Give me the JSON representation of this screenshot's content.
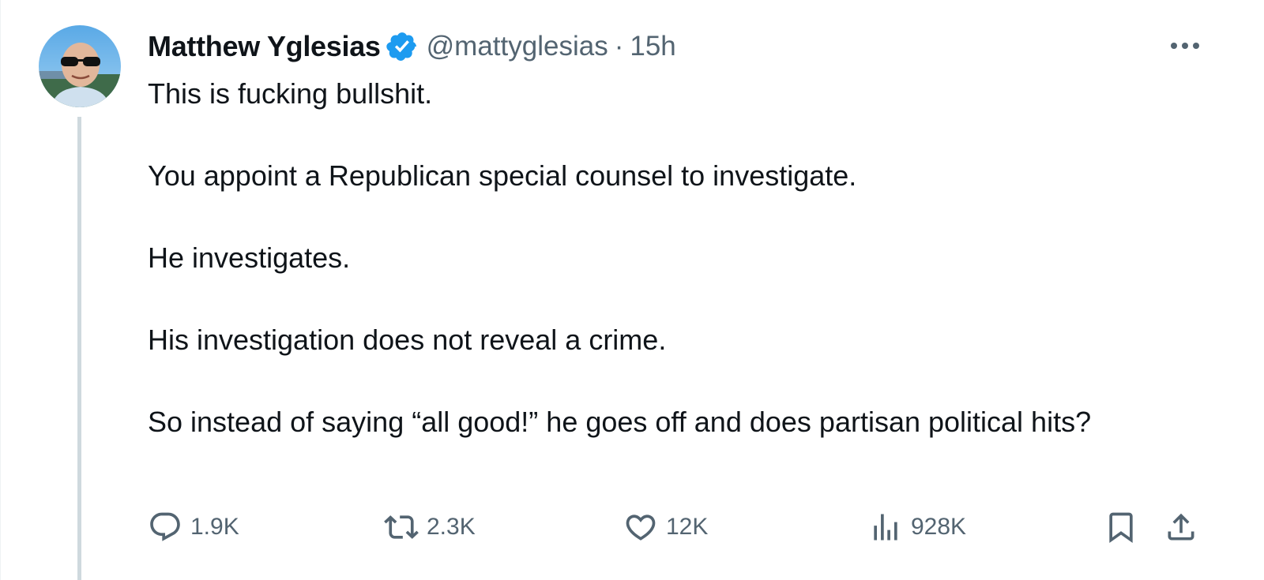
{
  "author": {
    "display_name": "Matthew Yglesias",
    "handle": "@mattyglesias",
    "separator": "·",
    "timestamp": "15h",
    "verified_color": "#1d9bf0"
  },
  "tweet": {
    "paragraphs": [
      "This is fucking bullshit.",
      "You appoint a Republican special counsel to investigate.",
      "He investigates.",
      "His investigation does not reveal a crime.",
      "So instead of saying “all good!” he goes off and does partisan political hits?"
    ]
  },
  "actions": {
    "replies": "1.9K",
    "retweets": "2.3K",
    "likes": "12K",
    "views": "928K"
  },
  "icons": {
    "avatar": "profile-photo",
    "verified": "verified-badge-icon",
    "more": "more-dots-icon",
    "reply": "reply-bubble-icon",
    "retweet": "retweet-arrows-icon",
    "like": "heart-icon",
    "views": "bar-chart-icon",
    "bookmark": "bookmark-icon",
    "share": "share-upload-icon"
  },
  "colors": {
    "text": "#0f1419",
    "secondary": "#536471",
    "thread_line": "#cfd9de"
  }
}
